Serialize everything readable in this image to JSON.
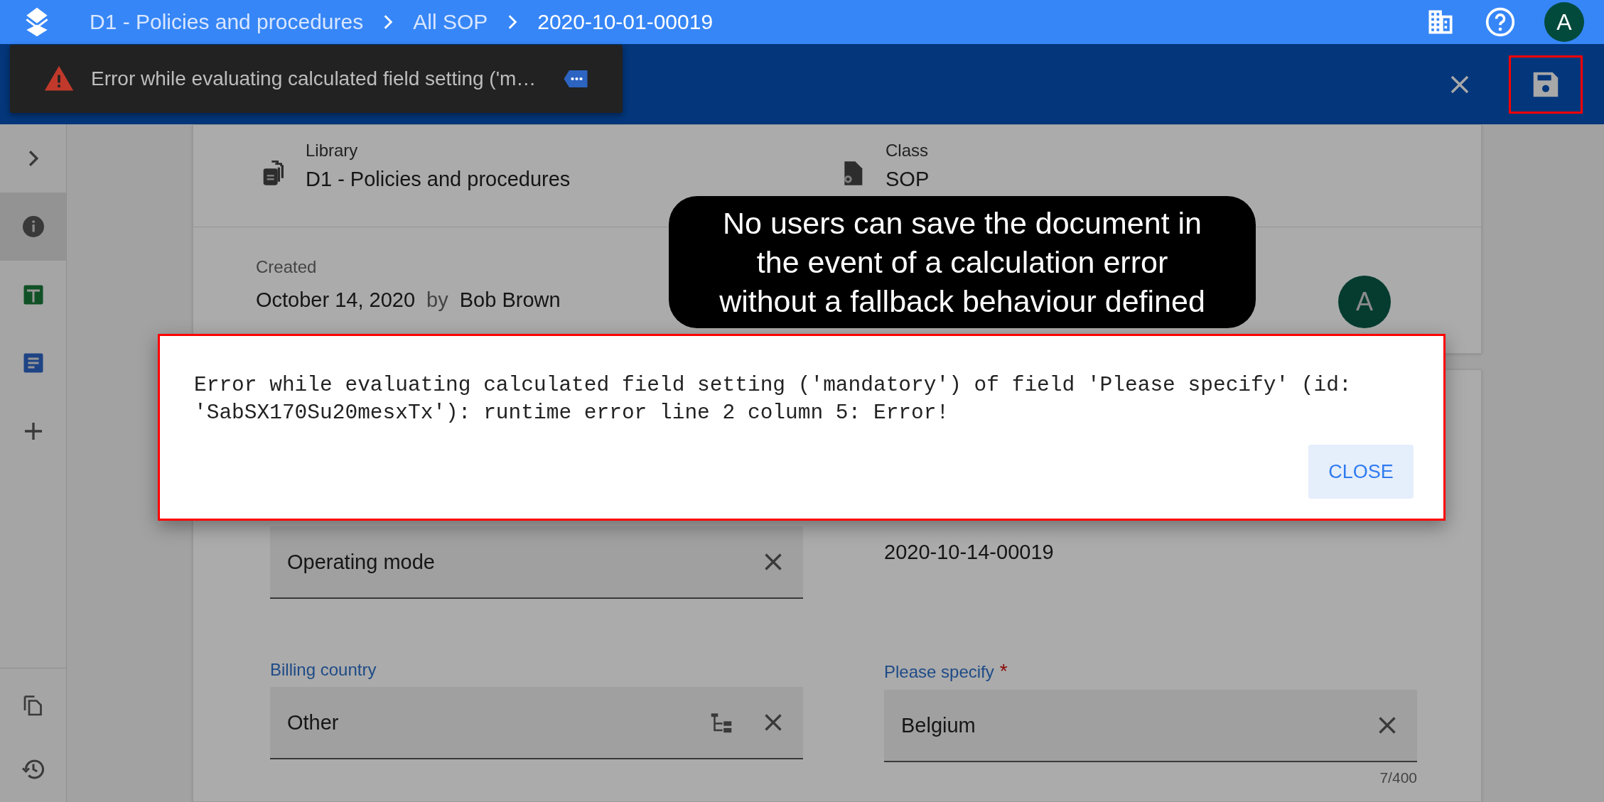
{
  "app_bar": {
    "breadcrumbs": [
      {
        "label": "D1 - Policies and procedures",
        "current": false
      },
      {
        "label": "All SOP",
        "current": false
      },
      {
        "label": "2020-10-01-00019",
        "current": true
      }
    ],
    "avatar": "A"
  },
  "toolbar": {
    "snackbar": {
      "message": "Error while evaluating calculated field setting ('m…"
    },
    "save_highlighted": true
  },
  "sidebar": {
    "items": [
      {
        "kind": "expand",
        "selected": false
      },
      {
        "kind": "info",
        "selected": true
      },
      {
        "kind": "sheet",
        "selected": false
      },
      {
        "kind": "doc",
        "selected": false
      },
      {
        "kind": "add",
        "selected": false
      }
    ],
    "bottom_items": [
      {
        "kind": "copy"
      },
      {
        "kind": "history"
      }
    ]
  },
  "document": {
    "library": {
      "label": "Library",
      "value": "D1 - Policies and procedures"
    },
    "class": {
      "label": "Class",
      "value": "SOP"
    },
    "created": {
      "label": "Created",
      "date": "October 14, 2020",
      "by": "by",
      "author": "Bob Brown",
      "avatar": "A"
    },
    "fields": [
      {
        "kind": "select",
        "value": "Operating mode"
      },
      {
        "kind": "readonly",
        "value": "2020-10-14-00019"
      },
      {
        "kind": "tree_select",
        "label": "Billing country",
        "value": "Other"
      },
      {
        "kind": "text",
        "label": "Please specify",
        "required_mark": "*",
        "value": "Belgium",
        "counter": "7/400"
      }
    ]
  },
  "callout": {
    "text": "No users can save the document in\nthe event of a calculation error\nwithout a fallback behaviour defined"
  },
  "dialog": {
    "message": "Error while evaluating calculated field setting ('mandatory') of field 'Please specify' (id: 'SabSX170Su20mesxTx'): runtime error line 2 column 5: Error!",
    "button": "CLOSE",
    "highlighted": true
  }
}
